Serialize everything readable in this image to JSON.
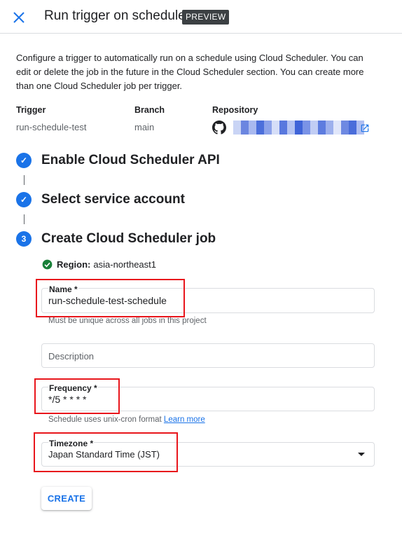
{
  "header": {
    "title": "Run trigger on schedule",
    "badge": "PREVIEW"
  },
  "intro": "Configure a trigger to automatically run on a schedule using Cloud Scheduler. You can edit or delete the job in the future in the Cloud Scheduler section. You can create more than one Cloud Scheduler job per trigger.",
  "info": {
    "trigger_label": "Trigger",
    "trigger_value": "run-schedule-test",
    "branch_label": "Branch",
    "branch_value": "main",
    "repository_label": "Repository",
    "repository_icon": "github-icon",
    "repository_value_redacted": true
  },
  "steps": [
    {
      "label": "Enable Cloud Scheduler API",
      "status": "done",
      "marker": "✓"
    },
    {
      "label": "Select service account",
      "status": "done",
      "marker": "✓"
    },
    {
      "label": "Create Cloud Scheduler job",
      "status": "current",
      "marker": "3"
    }
  ],
  "region": {
    "label": "Region:",
    "value": "asia-northeast1"
  },
  "form": {
    "name": {
      "label": "Name *",
      "value": "run-schedule-test-schedule",
      "helper": "Must be unique across all jobs in this project"
    },
    "description": {
      "placeholder": "Description",
      "value": ""
    },
    "frequency": {
      "label": "Frequency *",
      "value": "*/5 * * * *",
      "helper": "Schedule uses unix-cron format",
      "helper_link": "Learn more"
    },
    "timezone": {
      "label": "Timezone *",
      "value": "Japan Standard Time (JST)"
    }
  },
  "create_button": "CREATE",
  "colors": {
    "accent": "#1a73e8",
    "success": "#188038",
    "annotation": "#e8161c",
    "badge_bg": "#3c4043"
  }
}
